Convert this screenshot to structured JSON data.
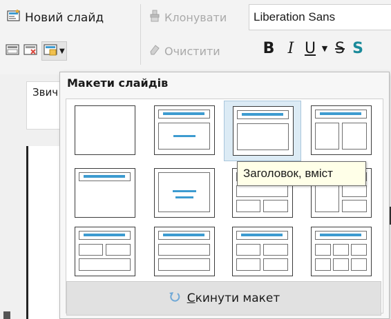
{
  "toolbar": {
    "new_slide_label": "Новий слайд",
    "clone_label": "Клонувати",
    "clear_label": "Очистити",
    "font_name": "Liberation Sans",
    "bold_label": "B",
    "italic_label": "I",
    "underline_label": "U",
    "strike_label": "S",
    "shadow_label": "S"
  },
  "left_panel": {
    "master_tab_label": "Звич"
  },
  "layouts_popup": {
    "title": "Макети слайдів",
    "tooltip": "Заголовок, вміст",
    "reset_first_letter": "С",
    "reset_rest": "кинути макет"
  },
  "colors": {
    "accent": "#3d9bd0",
    "hover_bg": "#dcebf5",
    "tooltip_bg": "#ffffe8"
  }
}
